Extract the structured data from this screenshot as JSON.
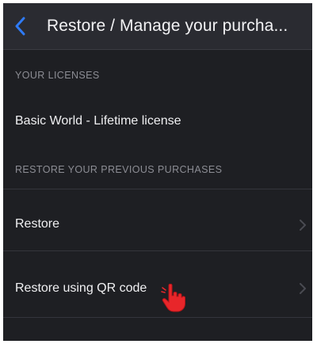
{
  "header": {
    "title": "Restore / Manage your purcha...",
    "back_icon": "chevron-left-icon"
  },
  "sections": {
    "licenses": {
      "title": "YOUR LICENSES",
      "items": [
        {
          "label": "Basic World - Lifetime license"
        }
      ]
    },
    "restore": {
      "title": "RESTORE YOUR PREVIOUS PURCHASES",
      "items": [
        {
          "label": "Restore",
          "icon": "chevron-right-icon"
        },
        {
          "label": "Restore using QR code",
          "icon": "chevron-right-icon"
        }
      ]
    }
  },
  "overlay": {
    "pointer_icon": "hand-pointer-icon"
  },
  "colors": {
    "background": "#1e1f23",
    "header_background": "#2a2b31",
    "accent": "#2f7bf6",
    "text_primary": "#f0f0f2",
    "text_secondary": "#8c8d94",
    "pointer": "#e8262a"
  }
}
